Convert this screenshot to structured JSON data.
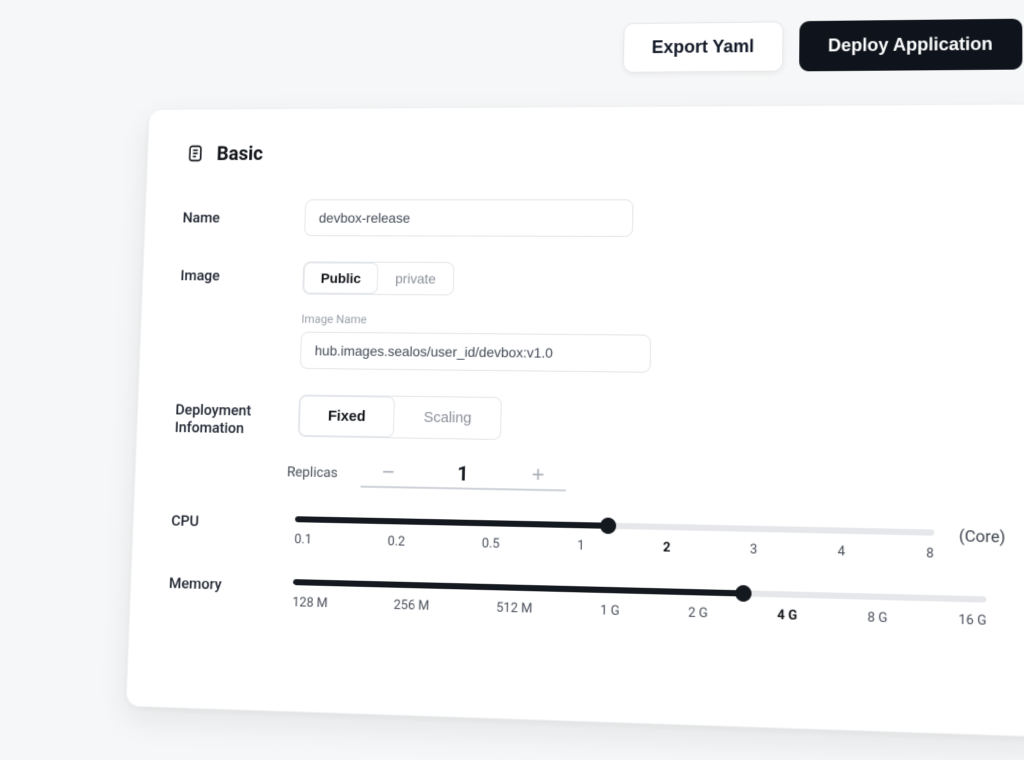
{
  "header": {
    "export_label": "Export Yaml",
    "deploy_label": "Deploy Application"
  },
  "card": {
    "title": "Basic"
  },
  "form": {
    "name_label": "Name",
    "name_value": "devbox-release",
    "image_label": "Image",
    "image_tabs": {
      "public": "Public",
      "private": "private"
    },
    "image_name_label": "Image Name",
    "image_name_value": "hub.images.sealos/user_id/devbox:v1.0",
    "deploy_label_1": "Deployment",
    "deploy_label_2": "Infomation",
    "deploy_tabs": {
      "fixed": "Fixed",
      "scaling": "Scaling"
    },
    "replicas_label": "Replicas",
    "replicas_value": "1"
  },
  "cpu": {
    "label": "CPU",
    "unit": "(Core)",
    "ticks": [
      "0.1",
      "0.2",
      "0.5",
      "1",
      "2",
      "3",
      "4",
      "8"
    ],
    "active_index": 4,
    "fill_percent": 50
  },
  "memory": {
    "label": "Memory",
    "ticks": [
      "128 M",
      "256 M",
      "512 M",
      "1 G",
      "2 G",
      "4 G",
      "8 G",
      "16 G"
    ],
    "active_index": 5,
    "fill_percent": 66
  }
}
